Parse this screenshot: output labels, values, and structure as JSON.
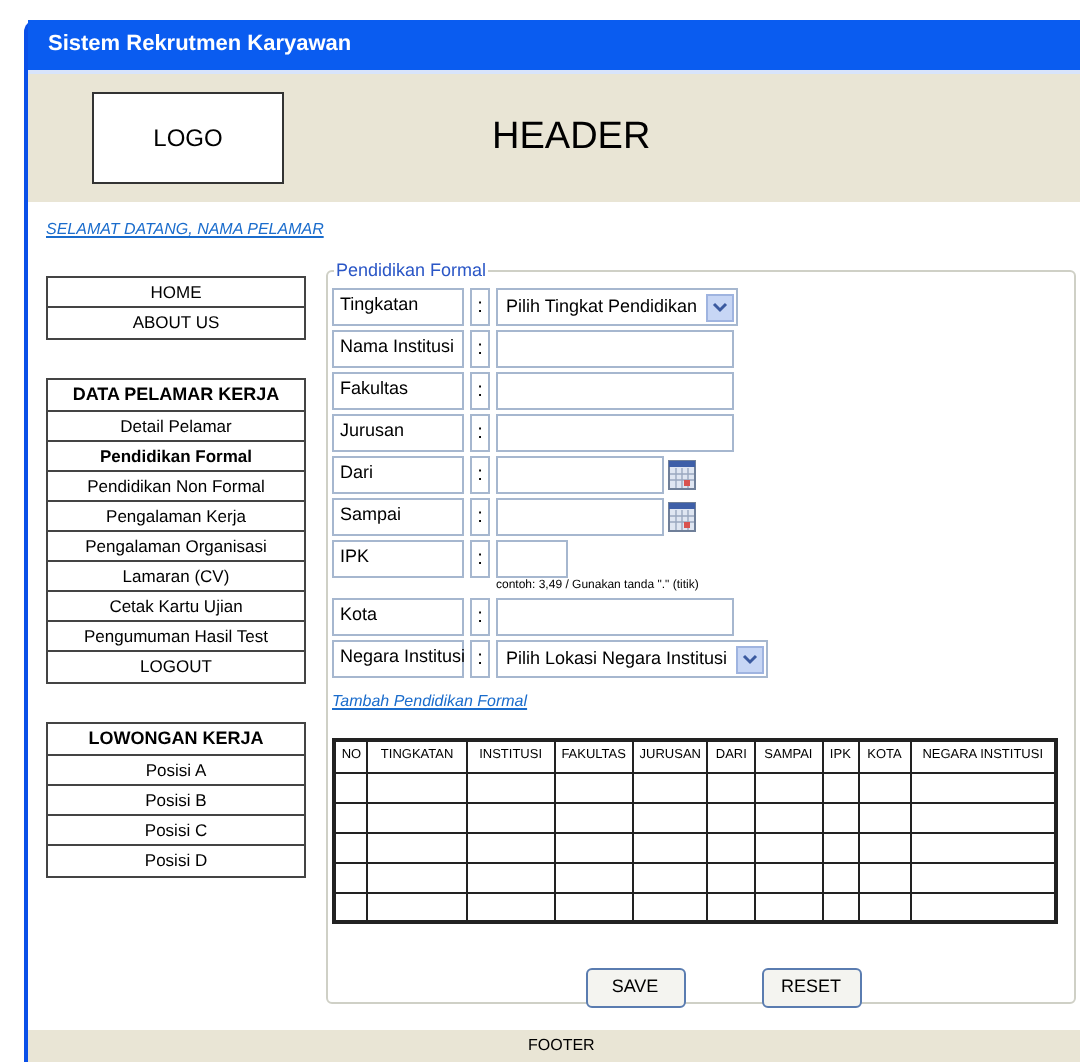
{
  "window": {
    "title": "Sistem Rekrutmen Karyawan"
  },
  "header": {
    "logo": "LOGO",
    "title": "HEADER"
  },
  "welcome_link": "SELAMAT DATANG, NAMA PELAMAR",
  "sidebar": {
    "groups": [
      {
        "items": [
          {
            "label": "HOME",
            "selected": false
          },
          {
            "label": "ABOUT US",
            "selected": false
          }
        ]
      },
      {
        "title": "DATA PELAMAR KERJA",
        "items": [
          {
            "label": "Detail Pelamar",
            "selected": false
          },
          {
            "label": "Pendidikan Formal",
            "selected": true
          },
          {
            "label": "Pendidikan Non Formal",
            "selected": false
          },
          {
            "label": "Pengalaman Kerja",
            "selected": false
          },
          {
            "label": "Pengalaman Organisasi",
            "selected": false
          },
          {
            "label": "Lamaran (CV)",
            "selected": false
          },
          {
            "label": "Cetak Kartu Ujian",
            "selected": false
          },
          {
            "label": "Pengumuman Hasil Test",
            "selected": false
          },
          {
            "label": "LOGOUT",
            "selected": false
          }
        ]
      },
      {
        "title": "LOWONGAN KERJA",
        "items": [
          {
            "label": "Posisi A",
            "selected": false
          },
          {
            "label": "Posisi B",
            "selected": false
          },
          {
            "label": "Posisi C",
            "selected": false
          },
          {
            "label": "Posisi D",
            "selected": false
          }
        ]
      }
    ]
  },
  "form": {
    "legend": "Pendidikan Formal",
    "fields": [
      {
        "label": "Tingkatan",
        "colon": ":",
        "kind": "select",
        "value": "Pilih Tingkat Pendidikan"
      },
      {
        "label": "Nama Institusi",
        "colon": ":",
        "kind": "text"
      },
      {
        "label": "Fakultas",
        "colon": ":",
        "kind": "text"
      },
      {
        "label": "Jurusan",
        "colon": ":",
        "kind": "text"
      },
      {
        "label": "Dari",
        "colon": ":",
        "kind": "date"
      },
      {
        "label": "Sampai",
        "colon": ":",
        "kind": "date"
      },
      {
        "label": "IPK",
        "colon": ":",
        "kind": "short",
        "hint": "contoh: 3,49 / Gunakan tanda \".\" (titik)"
      },
      {
        "label": "Kota",
        "colon": ":",
        "kind": "text"
      },
      {
        "label": "Negara Institusi",
        "colon": ":",
        "kind": "select",
        "value": "Pilih Lokasi Negara Institusi"
      }
    ],
    "add_link": "Tambah Pendidikan Formal"
  },
  "table": {
    "columns": [
      "NO",
      "TINGKATAN",
      "INSTITUSI",
      "FAKULTAS",
      "JURUSAN",
      "DARI",
      "SAMPAI",
      "IPK",
      "KOTA",
      "NEGARA INSTITUSI"
    ],
    "rows": [
      {
        "kind": "empty"
      },
      {
        "kind": "empty"
      },
      {
        "kind": "empty"
      },
      {
        "kind": "empty"
      },
      {
        "kind": "empty"
      }
    ]
  },
  "buttons": [
    "SAVE",
    "RESET"
  ],
  "footer": "FOOTER"
}
